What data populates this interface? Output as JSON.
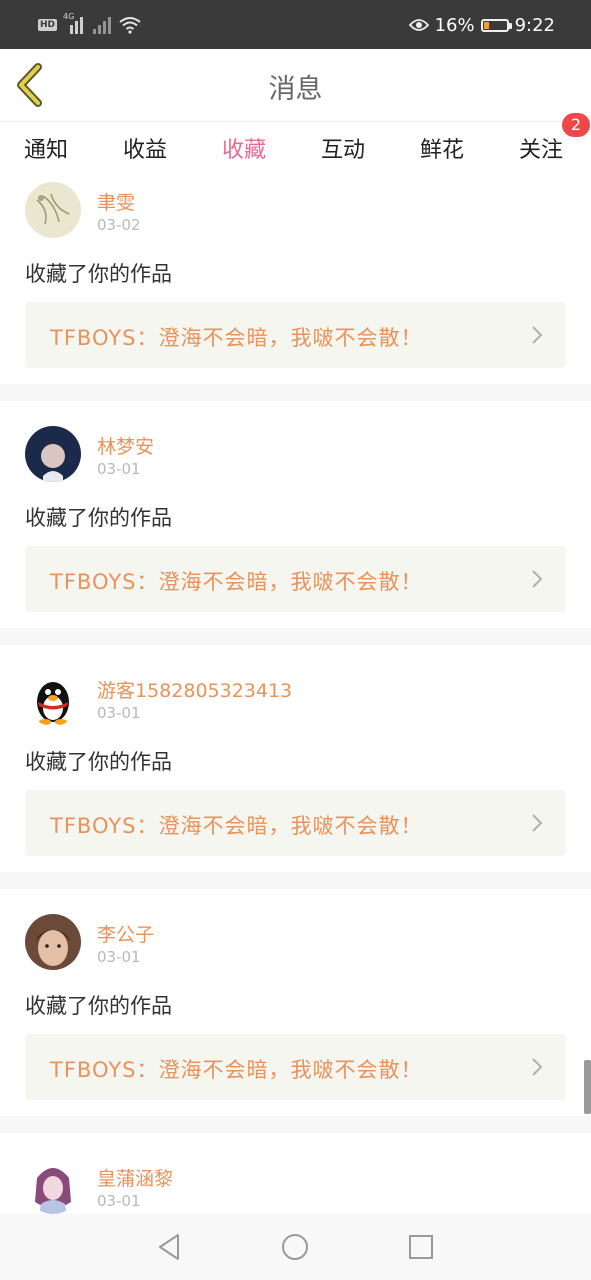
{
  "status_bar": {
    "hd": "HD",
    "network": "4G",
    "battery": "16%",
    "time": "9:22",
    "icons": [
      "hd-icon",
      "signal-icon",
      "no-signal-icon",
      "wifi-icon",
      "eye-icon",
      "battery-icon"
    ]
  },
  "header": {
    "title": "消息",
    "back_icon": "chevron-left-icon"
  },
  "tabs": [
    {
      "label": "通知"
    },
    {
      "label": "收益"
    },
    {
      "label": "收藏",
      "active": true
    },
    {
      "label": "互动"
    },
    {
      "label": "鲜花"
    },
    {
      "label": "关注",
      "badge": "2"
    }
  ],
  "items": [
    {
      "user": "聿雯",
      "date": "03-02",
      "action": "收藏了你的作品",
      "work": "TFBOYS：澄海不会暗，我啵不会散！"
    },
    {
      "user": "林梦安",
      "date": "03-01",
      "action": "收藏了你的作品",
      "work": "TFBOYS：澄海不会暗，我啵不会散！"
    },
    {
      "user": "游客1582805323413",
      "date": "03-01",
      "action": "收藏了你的作品",
      "work": "TFBOYS：澄海不会暗，我啵不会散！"
    },
    {
      "user": "李公子",
      "date": "03-01",
      "action": "收藏了你的作品",
      "work": "TFBOYS：澄海不会暗，我啵不会散！"
    },
    {
      "user": "皇蒲涵黎",
      "date": "03-01"
    }
  ],
  "colors": {
    "accent_pink": "#e76b93",
    "username_orange": "#e8935b",
    "badge_red": "#f04848",
    "back_icon_yellow": "#e4cf4d"
  }
}
